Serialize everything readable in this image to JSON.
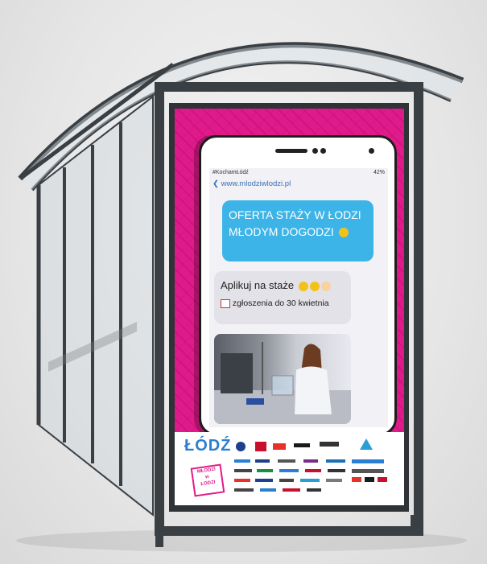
{
  "poster": {
    "status_left": "#KochamŁódź",
    "status_right": "42%",
    "url": "www.mlodziwlodzi.pl",
    "headline_line1": "OFERTA STAŻY W ŁODZI",
    "headline_line2": "MŁODYM DOGODZI",
    "apply_text": "Aplikuj na staże",
    "deadline_text": "zgłoszenia do 30 kwietnia",
    "logo_text": "ŁÓDŹ",
    "stamp_line1": "MŁODZI",
    "stamp_line2": "w",
    "stamp_line3": "ŁODZI"
  },
  "colors": {
    "poster_background": "#e11a8b",
    "bubble_blue": "#3db4e8",
    "shelter_frame": "#3a3f44"
  }
}
